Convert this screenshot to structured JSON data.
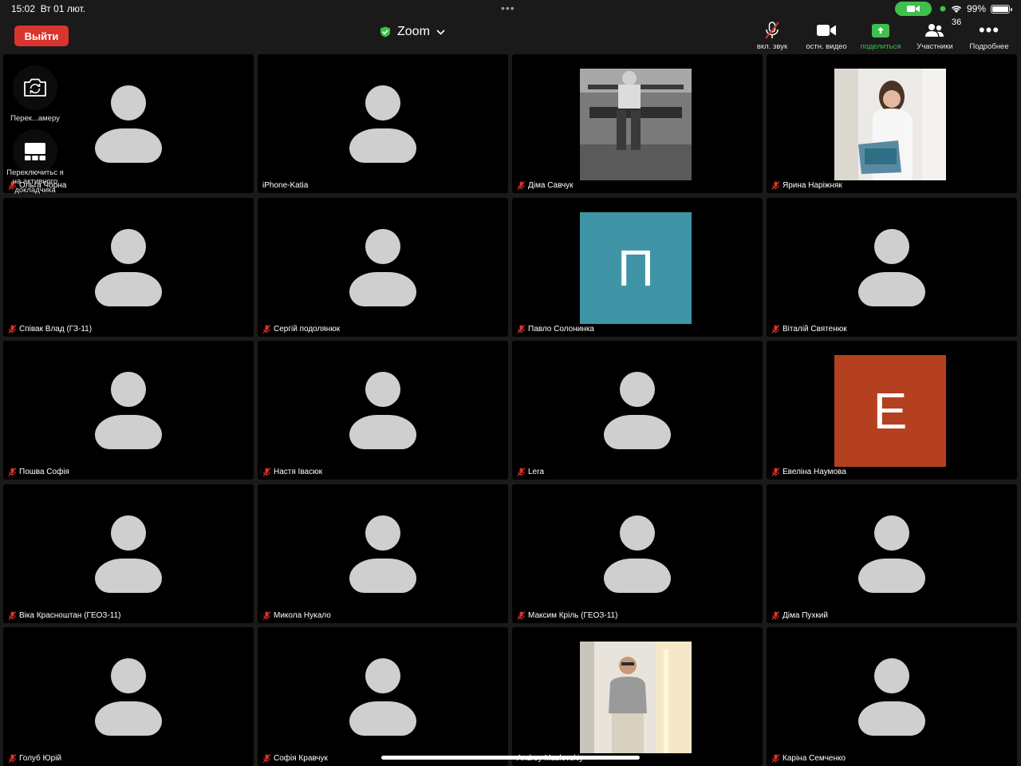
{
  "status_bar": {
    "time": "15:02",
    "date": "Вт 01 лют.",
    "battery": "99%",
    "battery_level": 0.99
  },
  "header": {
    "leave_label": "Выйти",
    "meeting_title": "Zoom"
  },
  "toolbar": {
    "unmute_label": "вкл. звук",
    "stop_video_label": "остн. видео",
    "share_label": "поделиться",
    "participants_label": "Участники",
    "participants_count": "36",
    "more_label": "Подробнее"
  },
  "overlay": {
    "switch_camera_label": "Перек...амеру",
    "switch_speaker_label": "Переключитьс я на активного докладчика"
  },
  "colors": {
    "leave": "#d9352e",
    "accent_green": "#3fbf4f",
    "mic_muted": "#e0302a",
    "tile_bg": "#000000",
    "avatar_gray": "#cfcfcf",
    "letter_p_bg": "#3f95a6",
    "letter_e_bg": "#b5401f"
  },
  "tiles": [
    {
      "name": "Ольга Чорна",
      "muted": true,
      "kind": "placeholder"
    },
    {
      "name": "iPhone-Katia",
      "muted": false,
      "kind": "placeholder"
    },
    {
      "name": "Діма Савчук",
      "muted": true,
      "kind": "photo"
    },
    {
      "name": "Ярина Наріжняк",
      "muted": true,
      "kind": "photo"
    },
    {
      "name": "Співак Влад (ГЗ-11)",
      "muted": true,
      "kind": "placeholder"
    },
    {
      "name": "Сергій подолянюк",
      "muted": true,
      "kind": "placeholder"
    },
    {
      "name": "Павло Солонинка",
      "muted": true,
      "kind": "letter",
      "letter": "П"
    },
    {
      "name": "Віталій Святенюк",
      "muted": true,
      "kind": "placeholder"
    },
    {
      "name": "Пошва Софія",
      "muted": true,
      "kind": "placeholder"
    },
    {
      "name": "Настя Івасюк",
      "muted": true,
      "kind": "placeholder"
    },
    {
      "name": "Lera",
      "muted": true,
      "kind": "placeholder"
    },
    {
      "name": "Евеліна Наумова",
      "muted": true,
      "kind": "letter",
      "letter": "E"
    },
    {
      "name": "Віка Красноштан (ГЕОЗ-11)",
      "muted": true,
      "kind": "placeholder"
    },
    {
      "name": "Микола Нукало",
      "muted": true,
      "kind": "placeholder"
    },
    {
      "name": "Максим Кріль (ГЕОЗ-11)",
      "muted": true,
      "kind": "placeholder"
    },
    {
      "name": "Діма Пухкий",
      "muted": true,
      "kind": "placeholder"
    },
    {
      "name": "Голуб Юрій",
      "muted": true,
      "kind": "placeholder"
    },
    {
      "name": "Софія Кравчук",
      "muted": true,
      "kind": "placeholder"
    },
    {
      "name": "Andrey Maslovskiy",
      "muted": false,
      "kind": "photo"
    },
    {
      "name": "Каріна Семченко",
      "muted": true,
      "kind": "placeholder"
    }
  ]
}
